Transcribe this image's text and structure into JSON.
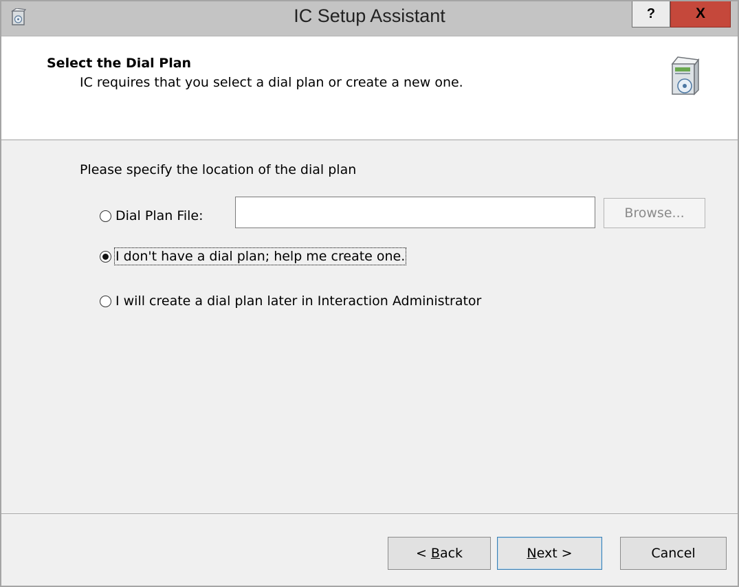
{
  "window": {
    "title": "IC Setup Assistant",
    "help_label": "?",
    "close_label": "X"
  },
  "header": {
    "title": "Select the Dial Plan",
    "subtitle": "IC requires that you select a dial plan or create a new one."
  },
  "content": {
    "prompt": "Please specify the location of the dial plan",
    "options": [
      {
        "label": "Dial Plan File:",
        "checked": false
      },
      {
        "label": "I don't have a dial plan; help me create one.",
        "checked": true
      },
      {
        "label": "I will create a dial plan later in Interaction Administrator",
        "checked": false
      }
    ],
    "file_input_value": "",
    "browse_label": "Browse..."
  },
  "footer": {
    "back_mnemonic": "B",
    "back_prefix": "< ",
    "back_rest": "ack",
    "next_mnemonic": "N",
    "next_rest": "ext >",
    "cancel_label": "Cancel"
  },
  "colors": {
    "titlebar": "#c4c4c4",
    "close_button": "#c5483b",
    "header_bg": "#ffffff",
    "body_bg": "#f0f0f0"
  },
  "icons": {
    "app": "setup-box-icon",
    "header": "software-box-cd-icon"
  }
}
